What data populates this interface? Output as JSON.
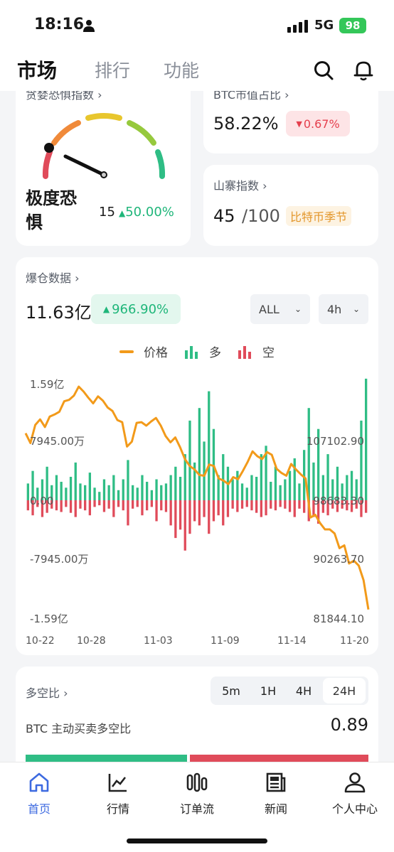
{
  "status": {
    "time": "18:16",
    "network": "5G",
    "battery": "98"
  },
  "nav": {
    "tabs": [
      "市场",
      "排行",
      "功能"
    ]
  },
  "fear_greed": {
    "title": "贪婪恐惧指数",
    "label": "极度恐惧",
    "label_line1": "极度恐",
    "label_line2": "惧",
    "value": "15",
    "change": "50.00%",
    "gauge_level": 0.15
  },
  "btc_dominance": {
    "title": "BTC市值占比",
    "value": "58.22%",
    "change": "0.67%"
  },
  "altcoin": {
    "title": "山寨指数",
    "value": "45",
    "max": "/100",
    "tag": "比特币季节"
  },
  "liquidation": {
    "title": "爆仓数据",
    "total": "11.63亿",
    "change": "966.90%",
    "filter_scope": "ALL",
    "filter_interval": "4h",
    "legend": {
      "price": "价格",
      "long": "多",
      "short": "空"
    },
    "colors": {
      "price": "#f29a1a",
      "long": "#2fbd85",
      "short": "#e04b5a"
    }
  },
  "chart_data": {
    "type": "bar",
    "title": "爆仓数据",
    "x_ticks": [
      "10-22",
      "10-28",
      "11-03",
      "11-09",
      "11-14",
      "11-20"
    ],
    "y_left_ticks": [
      "1.59亿",
      "7945.00万",
      "0.00",
      "-7945.00万",
      "-1.59亿"
    ],
    "y_right_ticks": [
      "107102.90",
      "98683.30",
      "90263.70",
      "81844.10"
    ],
    "ylim_left": [
      -159000000,
      159000000
    ],
    "ylim_right": [
      81844.1,
      115522.5
    ],
    "series": [
      {
        "name": "价格",
        "type": "line",
        "values": [
          108200,
          106800,
          109400,
          110200,
          109100,
          110600,
          110900,
          111300,
          112800,
          113000,
          113600,
          114900,
          114200,
          113300,
          112500,
          113500,
          112900,
          111900,
          111400,
          110100,
          109800,
          106300,
          107000,
          109700,
          109800,
          109300,
          109900,
          110400,
          109300,
          107800,
          106900,
          107600,
          106200,
          104500,
          103500,
          103000,
          102200,
          102100,
          103700,
          103500,
          101700,
          101400,
          100900,
          101900,
          101600,
          102800,
          104100,
          105600,
          104900,
          104500,
          105500,
          105100,
          103100,
          102500,
          102100,
          103800,
          103000,
          102300,
          101700,
          96100,
          96500,
          95300,
          94400,
          94400,
          93800,
          91700,
          92100,
          89500,
          89900,
          89200,
          87100,
          82900
        ]
      },
      {
        "name": "多",
        "type": "bar",
        "values": [
          20,
          35,
          15,
          25,
          40,
          18,
          30,
          22,
          15,
          28,
          45,
          20,
          18,
          33,
          15,
          10,
          25,
          18,
          30,
          12,
          25,
          48,
          18,
          15,
          30,
          22,
          12,
          25,
          18,
          20,
          30,
          40,
          28,
          55,
          95,
          45,
          110,
          70,
          130,
          85,
          30,
          55,
          40,
          25,
          35,
          20,
          15,
          30,
          28,
          55,
          65,
          22,
          40,
          18,
          25,
          35,
          50,
          20,
          60,
          110,
          45,
          85,
          30,
          55,
          25,
          40,
          20,
          30,
          35,
          25,
          95,
          145
        ]
      },
      {
        "name": "空",
        "type": "bar",
        "values": [
          12,
          18,
          8,
          20,
          15,
          10,
          12,
          14,
          8,
          15,
          20,
          10,
          12,
          18,
          8,
          6,
          14,
          10,
          20,
          8,
          12,
          30,
          10,
          8,
          18,
          12,
          8,
          25,
          12,
          14,
          30,
          45,
          35,
          60,
          40,
          25,
          30,
          20,
          40,
          25,
          18,
          30,
          20,
          10,
          14,
          10,
          8,
          12,
          15,
          20,
          18,
          10,
          12,
          8,
          10,
          14,
          20,
          10,
          15,
          25,
          20,
          28,
          15,
          18,
          10,
          14,
          10,
          12,
          14,
          10,
          20,
          15
        ]
      }
    ],
    "legend_position": "top-center"
  },
  "long_short": {
    "title": "多空比",
    "intervals": [
      "5m",
      "1H",
      "4H",
      "24H"
    ],
    "selected": "24H",
    "row_label": "BTC 主动买卖多空比",
    "row_value": "0.89",
    "ratio_long": 0.47
  },
  "tabbar": {
    "items": [
      {
        "label": "首页",
        "icon": "home-icon"
      },
      {
        "label": "行情",
        "icon": "chart-icon"
      },
      {
        "label": "订单流",
        "icon": "orderflow-icon"
      },
      {
        "label": "新闻",
        "icon": "news-icon"
      },
      {
        "label": "个人中心",
        "icon": "profile-icon"
      }
    ]
  }
}
